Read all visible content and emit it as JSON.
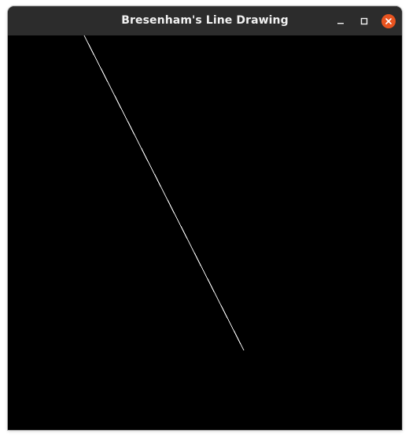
{
  "window": {
    "title": "Bresenham's Line Drawing"
  },
  "controls": {
    "minimize_icon": "minimize-icon",
    "maximize_icon": "maximize-icon",
    "close_icon": "close-icon"
  },
  "colors": {
    "titlebar": "#2c2c2c",
    "title_text": "#f2f2f2",
    "close_button": "#e95420",
    "canvas_background": "#000000",
    "line": "#ffffff"
  }
}
